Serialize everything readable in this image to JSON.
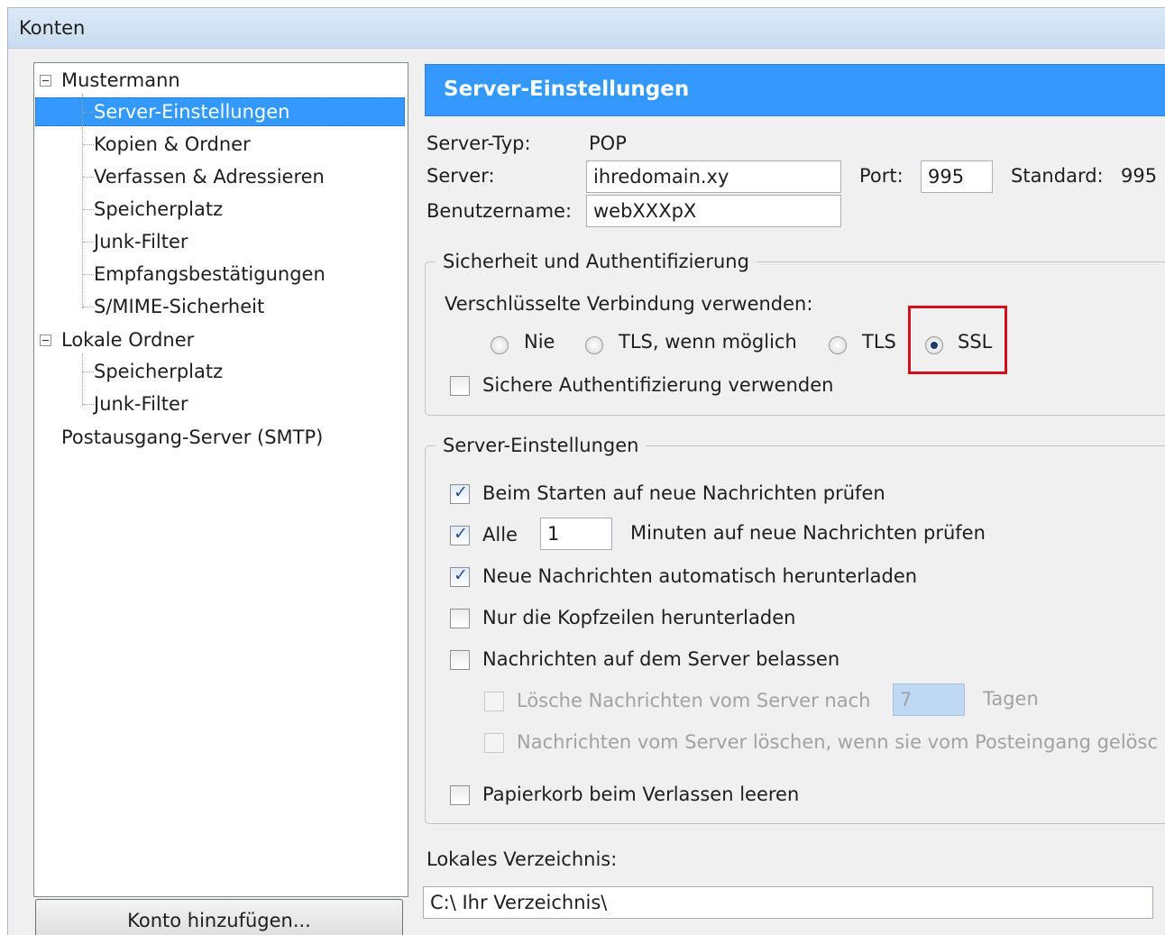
{
  "window": {
    "title": "Konten"
  },
  "tree": {
    "account": "Mustermann",
    "account_items": [
      "Server-Einstellungen",
      "Kopien & Ordner",
      "Verfassen & Adressieren",
      "Speicherplatz",
      "Junk-Filter",
      "Empfangsbestätigungen",
      "S/MIME-Sicherheit"
    ],
    "local": "Lokale Ordner",
    "local_items": [
      "Speicherplatz",
      "Junk-Filter"
    ],
    "smtp": "Postausgang-Server (SMTP)",
    "selected": "Server-Einstellungen"
  },
  "add_account_button": "Konto hinzufügen...",
  "panel": {
    "header": "Server-Einstellungen",
    "server_type_label": "Server-Typ:",
    "server_type_value": "POP",
    "server_label": "Server:",
    "server_value": "ihredomain.xy",
    "port_label": "Port:",
    "port_value": "995",
    "standard_label": "Standard:",
    "standard_value": "995",
    "username_label": "Benutzername:",
    "username_value": "webXXXpX"
  },
  "security": {
    "legend": "Sicherheit und Authentifizierung",
    "conn_label": "Verschlüsselte Verbindung verwenden:",
    "options": [
      "Nie",
      "TLS, wenn möglich",
      "TLS",
      "SSL"
    ],
    "selected": "SSL",
    "secure_auth": "Sichere Authentifizierung verwenden",
    "highlight_color": "#d0101a"
  },
  "server_settings": {
    "legend": "Server-Einstellungen",
    "check_on_start": "Beim Starten auf neue Nachrichten prüfen",
    "every_label": "Alle",
    "every_value": "1",
    "every_suffix": "Minuten auf neue Nachrichten prüfen",
    "auto_download": "Neue Nachrichten automatisch herunterladen",
    "headers_only": "Nur die Kopfzeilen herunterladen",
    "leave_on_server": "Nachrichten auf dem Server belassen",
    "delete_after": "Lösche Nachrichten vom Server nach",
    "delete_days": "7",
    "days_label": "Tagen",
    "delete_when": "Nachrichten vom Server löschen, wenn sie vom Posteingang gelösc",
    "empty_trash": "Papierkorb beim Verlassen leeren"
  },
  "local_dir": {
    "label": "Lokales Verzeichnis:",
    "value": "C:\\ Ihr Verzeichnis\\"
  },
  "accent_color": "#3399ff"
}
